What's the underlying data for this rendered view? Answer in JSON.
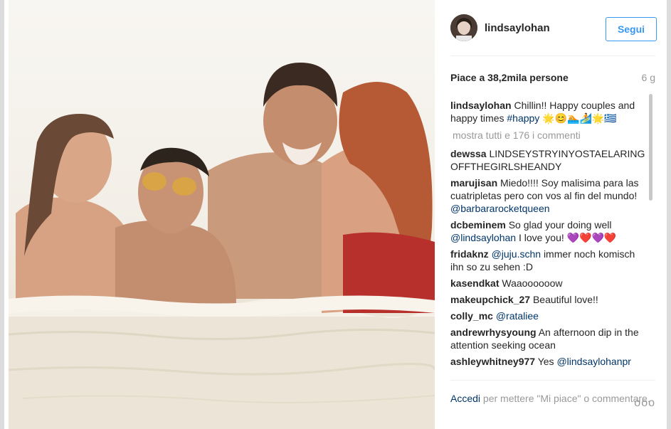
{
  "header": {
    "username": "lindsaylohan",
    "follow_label": "Segui"
  },
  "likes": {
    "text": "Piace a 38,2mila persone",
    "age": "6 g"
  },
  "caption": {
    "username": "lindsaylohan",
    "text": "Chillin!! Happy couples and happy times",
    "hashtag": "#happy",
    "emoji": "🌟😊🏊🏄🌟🇬🇷"
  },
  "view_all": "mostra tutti e 176 i commenti",
  "comments": [
    {
      "username": "dewssa",
      "text": "LINDSEYSTRYINYOSTAELARINGOFFTHEGIRLSHEANDY"
    },
    {
      "username": "marujisan",
      "text": "Miedo!!!! Soy malisima para las cuatripletas pero con vos al fin del mundo!",
      "mention": "@barbararocketqueen"
    },
    {
      "username": "dcbeminem",
      "text": "So glad your doing well",
      "mention": "@lindsaylohan",
      "text2": "I love you! 💜❤️💜❤️"
    },
    {
      "username": "fridaknz",
      "mention": "@juju.schn",
      "text": "immer noch komisch ihn so zu sehen :D"
    },
    {
      "username": "kasendkat",
      "text": "Waaoooooow"
    },
    {
      "username": "makeupchick_27",
      "text": "Beautiful love!!"
    },
    {
      "username": "colly_mc",
      "mention": "@rataliee"
    },
    {
      "username": "andrewrhysyoung",
      "text": "An afternoon dip in the attention seeking ocean"
    },
    {
      "username": "ashleywhitney977",
      "text": "Yes",
      "mention": "@lindsaylohanpr"
    }
  ],
  "footer": {
    "login": "Accedi",
    "text": "per mettere \"Mi piace\" o commentare.",
    "more": "ooo"
  },
  "colors": {
    "accent": "#3897f0",
    "link": "#003569",
    "muted": "#999999"
  }
}
